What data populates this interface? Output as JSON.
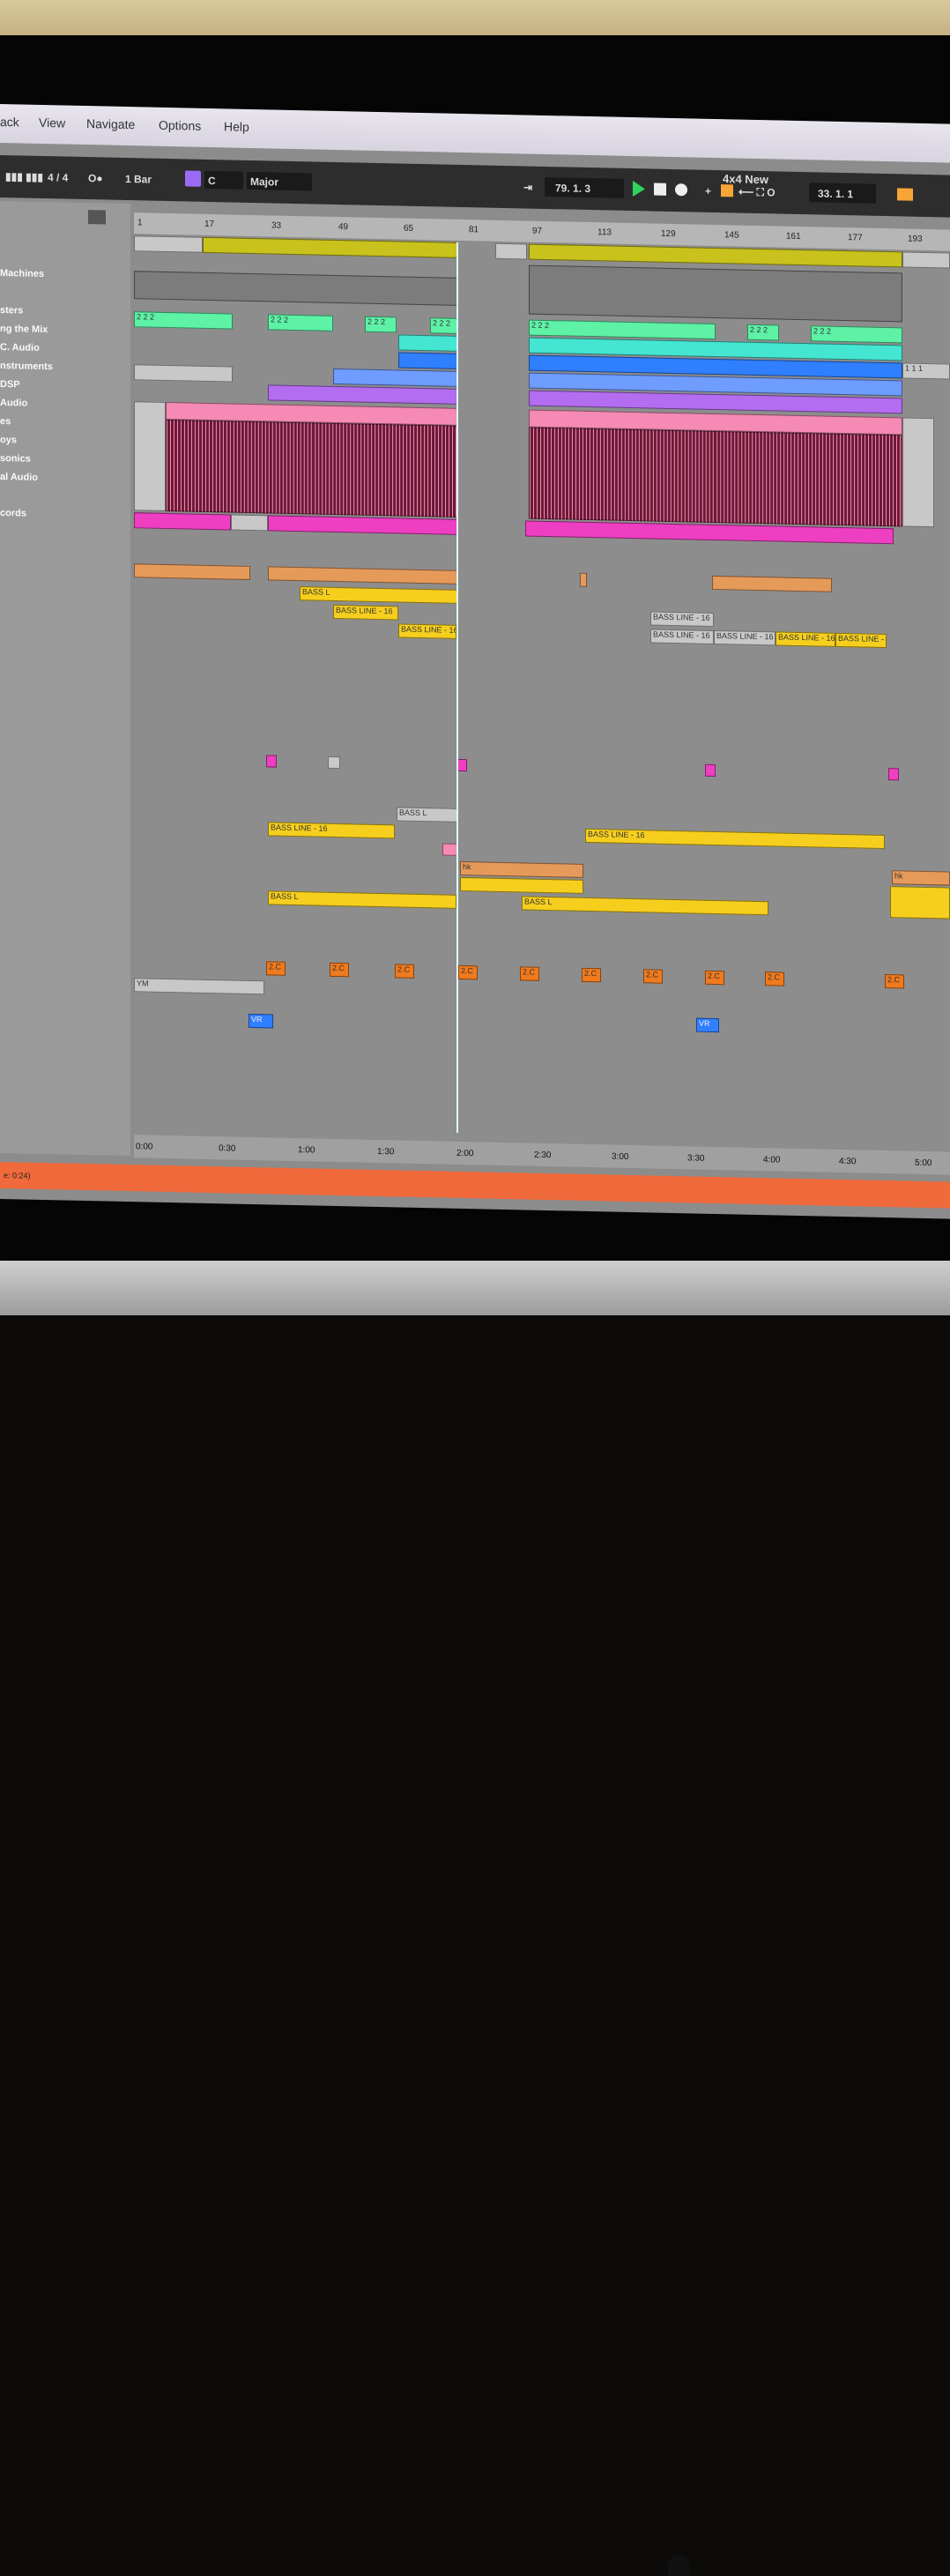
{
  "menu": [
    "ack",
    "View",
    "Navigate",
    "Options",
    "Help"
  ],
  "control_bar": {
    "time_signature": "4 / 4",
    "quantize": "1 Bar",
    "key": "C",
    "scale": "Major",
    "position": "79.  1.  3",
    "set_title": "4x4 New",
    "loop_length": "33.  1.  1"
  },
  "browser_items": [
    "Machines",
    "sters",
    "ng the Mix",
    "C. Audio",
    "nstruments",
    "DSP",
    "Audio",
    "es",
    "oys",
    "sonics",
    "al Audio",
    "cords"
  ],
  "bar_markers": [
    "1",
    "17",
    "33",
    "49",
    "65",
    "81",
    "97",
    "113",
    "129",
    "145",
    "161",
    "177",
    "193"
  ],
  "time_markers": [
    "0:00",
    "0:30",
    "1:00",
    "1:30",
    "2:00",
    "2:30",
    "3:00",
    "3:30",
    "4:00",
    "4:30",
    "5:00"
  ],
  "status_text": "e: 0:24)",
  "clip_labels": {
    "bass_line": "BASS LINE - 16",
    "bass_short": "BASS L",
    "hk": "hk",
    "twoc": "2.C",
    "ym": "YM",
    "vr": "VR",
    "twos": "2 2 2",
    "ones": "1 1 1"
  },
  "colors": {
    "yellow": "#c9c21d",
    "green": "#5df2a6",
    "teal": "#44e6d2",
    "blue": "#2f7fff",
    "lightblue": "#6f9cff",
    "purple": "#b46df0",
    "pink": "#f58ab4",
    "darkpink": "#6a1a36",
    "magenta": "#ee3ec1",
    "orange": "#e69a5a",
    "gold": "#f6cf1e",
    "orange2": "#f07a1e",
    "grey": "#c8c8c8"
  }
}
